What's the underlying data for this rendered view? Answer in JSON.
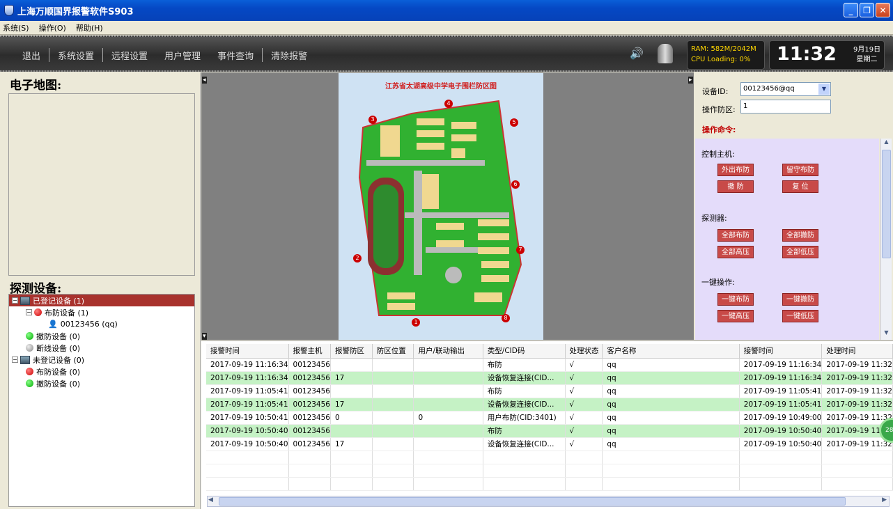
{
  "window": {
    "title": "上海万顺国界报警软件S903"
  },
  "menu": [
    "系统(S)",
    "操作(O)",
    "帮助(H)"
  ],
  "toolbar": {
    "items": [
      "退出",
      "系统设置",
      "远程设置",
      "用户管理",
      "事件查询",
      "清除报警"
    ]
  },
  "status": {
    "ram": "RAM: 582M/2042M",
    "cpu": "CPU Loading: 0%",
    "time": "11:32",
    "date": "9月19日",
    "weekday": "星期二"
  },
  "left": {
    "map_heading": "电子地图:",
    "devices_heading": "探测设备:",
    "tree": [
      {
        "label": "已登记设备 (1)",
        "level": 0,
        "icon": "computer-icon",
        "selected": true
      },
      {
        "label": "布防设备 (1)",
        "level": 1,
        "icon": "red-dot-icon"
      },
      {
        "label": "00123456 (qq)",
        "level": 2,
        "icon": "person-icon"
      },
      {
        "label": "撤防设备 (0)",
        "level": 1,
        "icon": "green-dot-icon"
      },
      {
        "label": "断线设备 (0)",
        "level": 1,
        "icon": "gray-dot-icon"
      },
      {
        "label": "未登记设备 (0)",
        "level": 0,
        "icon": "computer-icon"
      },
      {
        "label": "布防设备 (0)",
        "level": 1,
        "icon": "red-dot-icon"
      },
      {
        "label": "撤防设备 (0)",
        "level": 1,
        "icon": "green-dot-icon"
      }
    ]
  },
  "map": {
    "title": "江苏省太湖高级中学电子围栏防区图",
    "zones": [
      "1",
      "2",
      "3",
      "4",
      "5",
      "6",
      "7",
      "8"
    ]
  },
  "right": {
    "device_id_label": "设备ID:",
    "device_id_value": "00123456@qq",
    "zone_label": "操作防区:",
    "zone_value": "1",
    "commands_heading": "操作命令:",
    "host_label": "控制主机:",
    "host_buttons": [
      "外出布防",
      "留守布防",
      "撤 防",
      "复 位"
    ],
    "detector_label": "探测器:",
    "detector_buttons": [
      "全部布防",
      "全部撤防",
      "全部高压",
      "全部低压"
    ],
    "onekey_label": "一键操作:",
    "onekey_buttons": [
      "一键布防",
      "一键撤防",
      "一键高压",
      "一键低压"
    ]
  },
  "grid": {
    "columns": [
      "接警时间",
      "报警主机",
      "报警防区",
      "防区位置",
      "用户/联动输出",
      "类型/CID码",
      "处理状态",
      "客户名称",
      "接警时间",
      "处理时间"
    ],
    "rows": [
      {
        "cells": [
          "2017-09-19 11:16:34",
          "00123456",
          "",
          "",
          "",
          "布防",
          "√",
          "qq",
          "2017-09-19 11:16:34",
          "2017-09-19 11:32"
        ],
        "green": false
      },
      {
        "cells": [
          "2017-09-19 11:16:34",
          "00123456",
          "17",
          "",
          "",
          "设备恢复连接(CID...",
          "√",
          "qq",
          "2017-09-19 11:16:34",
          "2017-09-19 11:32"
        ],
        "green": true
      },
      {
        "cells": [
          "2017-09-19 11:05:41",
          "00123456",
          "",
          "",
          "",
          "布防",
          "√",
          "qq",
          "2017-09-19 11:05:41",
          "2017-09-19 11:32"
        ],
        "green": false
      },
      {
        "cells": [
          "2017-09-19 11:05:41",
          "00123456",
          "17",
          "",
          "",
          "设备恢复连接(CID...",
          "√",
          "qq",
          "2017-09-19 11:05:41",
          "2017-09-19 11:32"
        ],
        "green": true
      },
      {
        "cells": [
          "2017-09-19 10:50:41",
          "00123456",
          "0",
          "",
          "0",
          "用户布防(CID:3401)",
          "√",
          "qq",
          "2017-09-19 10:49:00",
          "2017-09-19 11:32"
        ],
        "green": false
      },
      {
        "cells": [
          "2017-09-19 10:50:40",
          "00123456",
          "",
          "",
          "",
          "布防",
          "√",
          "qq",
          "2017-09-19 10:50:40",
          "2017-09-19 11:32"
        ],
        "green": true
      },
      {
        "cells": [
          "2017-09-19 10:50:40",
          "00123456",
          "17",
          "",
          "",
          "设备恢复连接(CID...",
          "√",
          "qq",
          "2017-09-19 10:50:40",
          "2017-09-19 11:32"
        ],
        "green": false
      }
    ]
  },
  "badge": "28"
}
